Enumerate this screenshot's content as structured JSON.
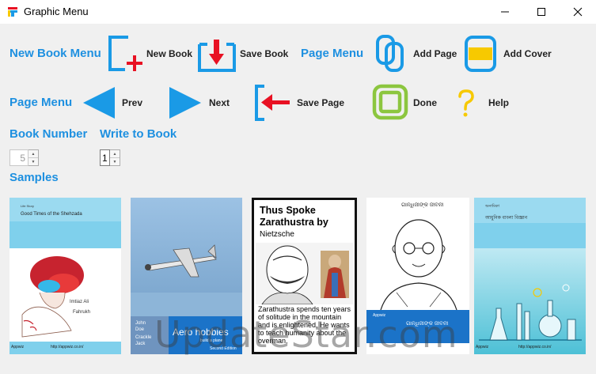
{
  "window": {
    "title": "Graphic Menu"
  },
  "toolbar_row1": {
    "new_book_menu": "New Book Menu",
    "new_book": "New Book",
    "save_book": "Save Book",
    "page_menu": "Page Menu",
    "add_page": "Add Page",
    "add_cover": "Add Cover"
  },
  "toolbar_row2": {
    "page_menu": "Page Menu",
    "prev": "Prev",
    "next": "Next",
    "save_page": "Save Page",
    "done": "Done",
    "help": "Help"
  },
  "book_number": {
    "label": "Book Number",
    "value": "5"
  },
  "write_to_book": {
    "label": "Write to Book",
    "value": "1"
  },
  "samples": {
    "label": "Samples",
    "cover1": {
      "top_small": "Life Story",
      "title": "Good Times of the Shehzada",
      "subtitle": "Imtiaz Ali",
      "author": "Fahrukh",
      "publisher": "Appwiz",
      "url": "http://appwiz.co.in/"
    },
    "cover2": {
      "author_first": "John",
      "author_last": "Doe",
      "coauthor_first": "Crackle",
      "coauthor_last": "Jack",
      "title": "Aero hobbies",
      "subtitle": "build a plane",
      "edition": "Second Edition"
    },
    "cover3": {
      "title": "Thus Spoke Zarathustra by",
      "author": "Nietzsche",
      "blurb": "Zarathustra spends ten years of solitude in the mountain and is enlightened. He wants to teach humanity about the overman."
    },
    "cover4": {
      "top_text": "ଗାନ୍ଧିଜୀଙ୍କ ଜୀବନୀ",
      "bottom_text": "ଗାନ୍ଧିଜୀଙ୍କ ଜୀବନୀ",
      "publisher": "Appwiz"
    },
    "cover5": {
      "top_text": "অনামিকা",
      "title": "আধুনিক বাংলা বিজ্ঞান",
      "publisher": "Appwiz",
      "url": "http://appwiz.co.in/"
    }
  },
  "watermark": "UpdateStar.com",
  "colors": {
    "accent_blue": "#1e90e0",
    "icon_blue": "#1a9ae6",
    "icon_red": "#e81123",
    "icon_green": "#8cc63f",
    "icon_yellow": "#f7c900"
  }
}
